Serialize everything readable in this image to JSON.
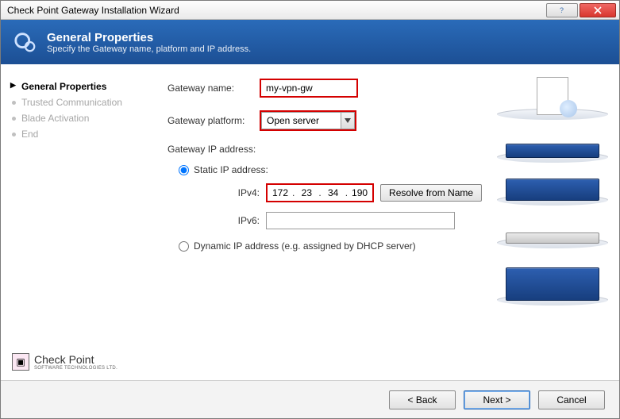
{
  "window": {
    "title": "Check Point Gateway Installation Wizard"
  },
  "header": {
    "title": "General Properties",
    "subtitle": "Specify the Gateway name, platform and IP address."
  },
  "sidebar": {
    "steps": [
      {
        "label": "General Properties",
        "active": true
      },
      {
        "label": "Trusted Communication",
        "active": false
      },
      {
        "label": "Blade Activation",
        "active": false
      },
      {
        "label": "End",
        "active": false
      }
    ],
    "logo": {
      "brand": "Check Point",
      "sub": "SOFTWARE TECHNOLOGIES LTD."
    }
  },
  "form": {
    "name_label": "Gateway name:",
    "name_value": "my-vpn-gw",
    "platform_label": "Gateway platform:",
    "platform_value": "Open server",
    "ip_section_label": "Gateway IP address:",
    "static_label": "Static IP address:",
    "ipv4_label": "IPv4:",
    "ipv4": {
      "a": "172",
      "b": "23",
      "c": "34",
      "d": "190"
    },
    "resolve_btn": "Resolve from Name",
    "ipv6_label": "IPv6:",
    "dynamic_label": "Dynamic IP address (e.g. assigned by DHCP server)"
  },
  "footer": {
    "back": "< Back",
    "next": "Next >",
    "cancel": "Cancel"
  }
}
